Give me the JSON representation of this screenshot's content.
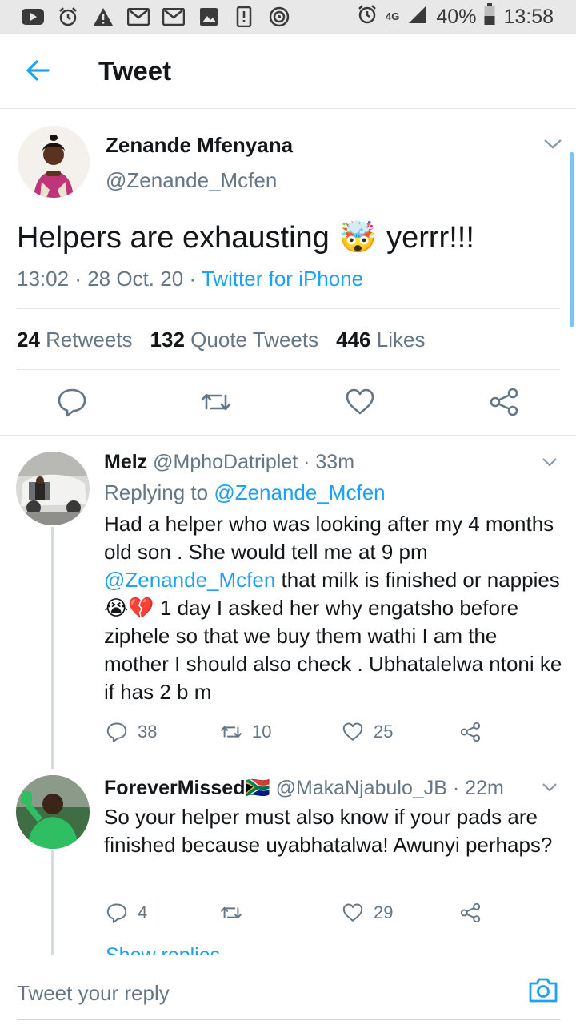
{
  "status_bar": {
    "battery": "40%",
    "time": "13:58",
    "network": "4G",
    "icons": [
      "youtube-icon",
      "alarm-icon",
      "warning-icon",
      "gmail-icon",
      "gmail-icon",
      "image-icon",
      "storage-icon",
      "hotspot-icon"
    ]
  },
  "app_bar": {
    "title": "Tweet"
  },
  "main_tweet": {
    "name": "Zenande Mfenyana",
    "handle": "@Zenande_Mcfen",
    "text_before": "Helpers are exhausting",
    "text_after": "yerrr!!!",
    "emoji": "🤯",
    "time": "13:02",
    "date": "28 Oct. 20",
    "source": "Twitter for iPhone",
    "retweets_count": "24",
    "retweets_label": "Retweets",
    "quotes_count": "132",
    "quotes_label": "Quote Tweets",
    "likes_count": "446",
    "likes_label": "Likes"
  },
  "replies": [
    {
      "name": "Melz",
      "handle": "@MphoDatriplet",
      "age": "33m",
      "replying_prefix": "Replying to",
      "replying_to": "@Zenande_Mcfen",
      "body_1": "Had a helper who was looking after my 4 months old son . She would tell me at 9 pm",
      "mention": "@Zenande_Mcfen",
      "body_2": " that milk is finished or nappies ",
      "emojis": "😭💔",
      "body_3": " 1 day I asked her why engatsho before ziphele so that we buy them wathi I am the mother I should also check . Ubhatalelwa ntoni ke if has 2 b m",
      "reply_count": "38",
      "retweet_count": "10",
      "like_count": "25"
    },
    {
      "name": "ForeverMissed",
      "flag": "🇿🇦",
      "handle": "@MakaNjabulo_JB",
      "age": "22m",
      "body": "So your helper must also know if your pads are finished because uyabhatalwa! Awunyi perhaps?",
      "reply_count": "4",
      "retweet_count": "",
      "like_count": "29"
    }
  ],
  "show_replies": "Show replies",
  "composer": {
    "placeholder": "Tweet your reply"
  },
  "colors": {
    "accent": "#1da1f2",
    "secondary_text": "#657786",
    "divider": "#e1e8ed",
    "status_bar": "#e8e8e8"
  }
}
